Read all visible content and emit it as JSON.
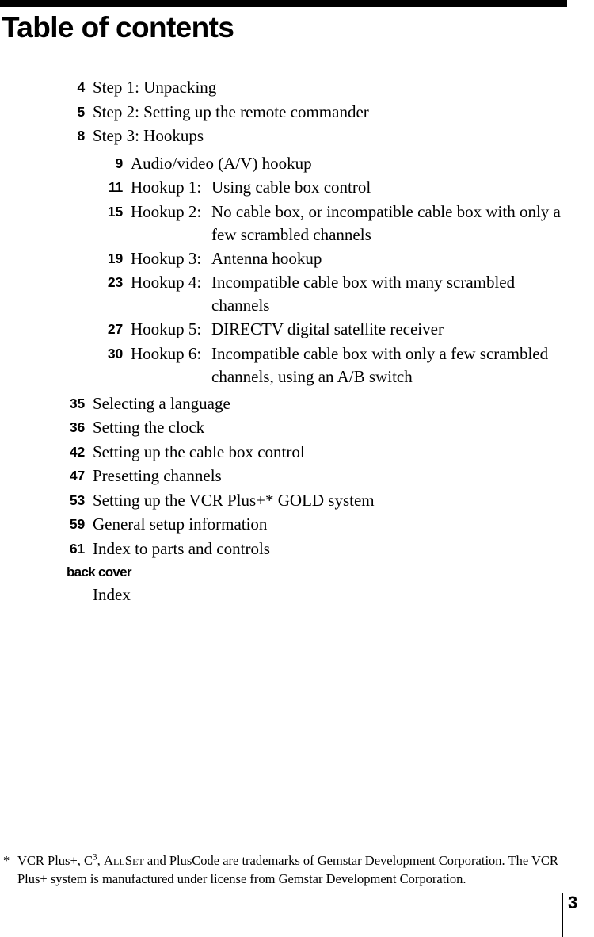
{
  "document": {
    "title": "Table of contents",
    "folio": "3"
  },
  "toc": {
    "entries": [
      {
        "level": 1,
        "page": "4",
        "title": "Step 1: Unpacking"
      },
      {
        "level": 1,
        "page": "5",
        "title": "Step 2: Setting up the remote commander"
      },
      {
        "level": 1,
        "page": "8",
        "title": "Step 3: Hookups"
      },
      {
        "level": 2,
        "page": "9",
        "label": "Audio/video (A/V) hookup",
        "desc": ""
      },
      {
        "level": 2,
        "page": "11",
        "label": "Hookup 1:",
        "desc": "Using cable box control"
      },
      {
        "level": 2,
        "page": "15",
        "label": "Hookup 2:",
        "desc": "No cable box, or incompatible cable box with only a few scrambled channels"
      },
      {
        "level": 2,
        "page": "19",
        "label": "Hookup 3:",
        "desc": "Antenna hookup"
      },
      {
        "level": 2,
        "page": "23",
        "label": "Hookup 4:",
        "desc": "Incompatible cable box with many scrambled channels"
      },
      {
        "level": 2,
        "page": "27",
        "label": "Hookup 5:",
        "desc": "DIRECTV digital satellite receiver"
      },
      {
        "level": 2,
        "page": "30",
        "label": "Hookup 6:",
        "desc": "Incompatible cable box with only a few scrambled channels, using an A/B switch"
      },
      {
        "level": 1,
        "page": "35",
        "title": "Selecting a language"
      },
      {
        "level": 1,
        "page": "36",
        "title": "Setting the clock"
      },
      {
        "level": 1,
        "page": "42",
        "title": "Setting up the cable box control"
      },
      {
        "level": 1,
        "page": "47",
        "title": "Presetting channels"
      },
      {
        "level": 1,
        "page": "53",
        "title": "Setting up the VCR Plus+* GOLD system"
      },
      {
        "level": 1,
        "page": "59",
        "title": "General setup information"
      },
      {
        "level": 1,
        "page": "61",
        "title": "Index to parts and controls"
      }
    ],
    "back_cover_label": "back cover",
    "back_cover_title": "Index"
  },
  "footnote": {
    "mark": "*",
    "part1": "VCR Plus+, C",
    "sup": "3",
    "part2": ", ",
    "smallcaps": "AllSet",
    "part3": " and PlusCode are trademarks of Gemstar Development Corporation.  The VCR Plus+ system is manufactured under license from Gemstar Development Corporation."
  }
}
